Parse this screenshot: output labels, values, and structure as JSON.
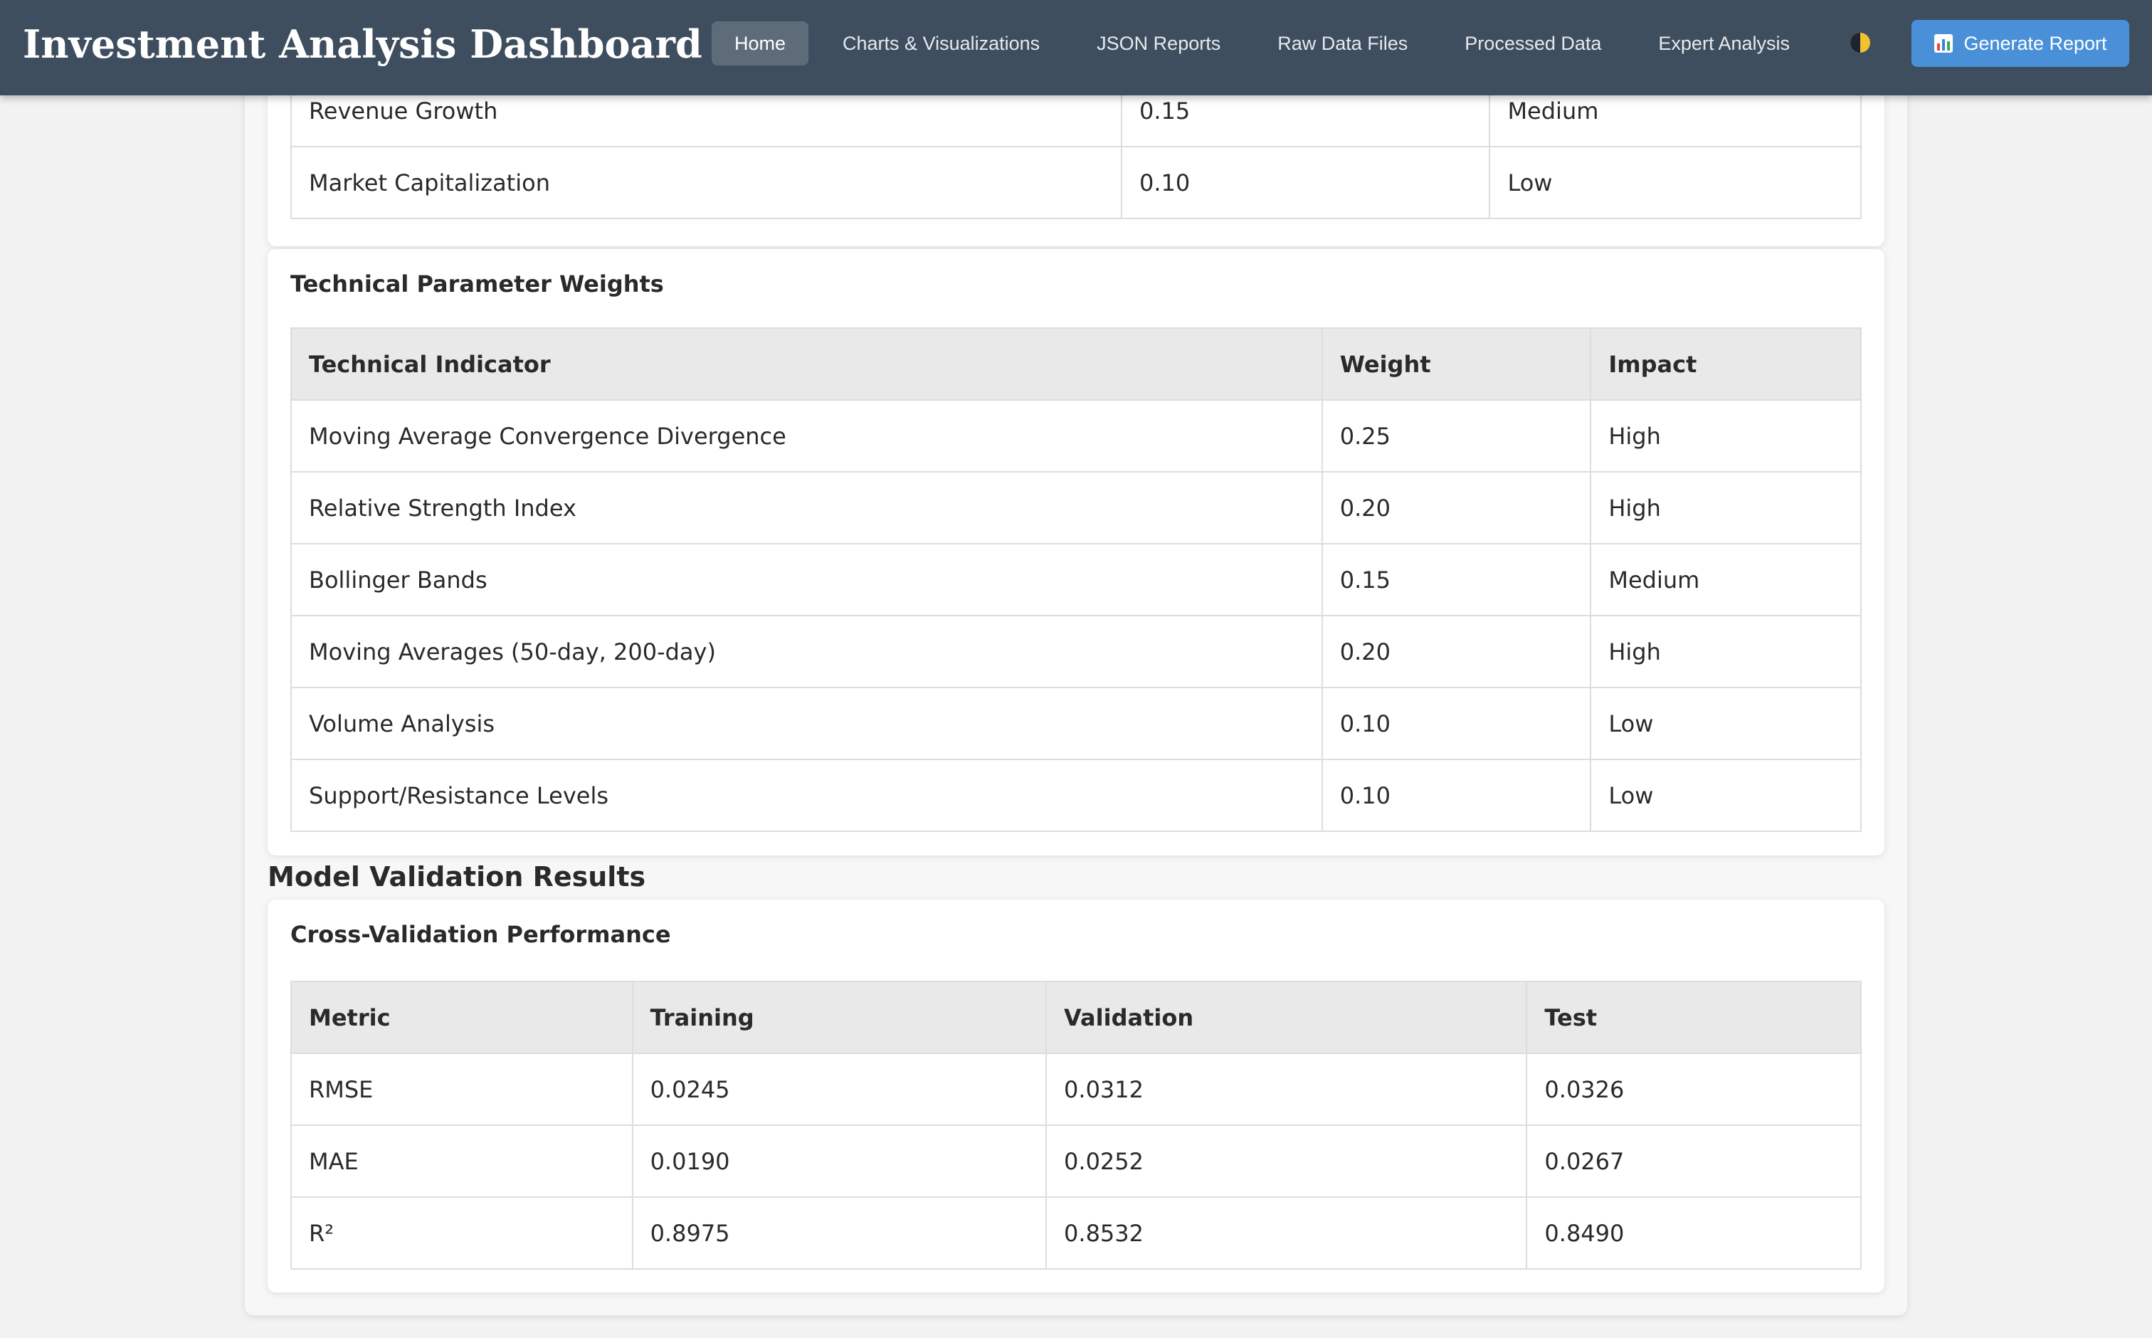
{
  "header": {
    "title": "Investment Analysis Dashboard",
    "nav": [
      {
        "label": "Home",
        "active": true
      },
      {
        "label": "Charts & Visualizations",
        "active": false
      },
      {
        "label": "JSON Reports",
        "active": false
      },
      {
        "label": "Raw Data Files",
        "active": false
      },
      {
        "label": "Processed Data",
        "active": false
      },
      {
        "label": "Expert Analysis",
        "active": false
      }
    ],
    "theme_toggle_icon": "half-moon-icon",
    "generate_button": {
      "label": "Generate Report",
      "icon": "chart-icon"
    }
  },
  "fundamental_table_partial": {
    "rows": [
      [
        "Revenue Growth",
        "0.15",
        "Medium"
      ],
      [
        "Market Capitalization",
        "0.10",
        "Low"
      ]
    ]
  },
  "technical_weights": {
    "title": "Technical Parameter Weights",
    "columns": [
      "Technical Indicator",
      "Weight",
      "Impact"
    ],
    "rows": [
      [
        "Moving Average Convergence Divergence",
        "0.25",
        "High"
      ],
      [
        "Relative Strength Index",
        "0.20",
        "High"
      ],
      [
        "Bollinger Bands",
        "0.15",
        "Medium"
      ],
      [
        "Moving Averages (50-day, 200-day)",
        "0.20",
        "High"
      ],
      [
        "Volume Analysis",
        "0.10",
        "Low"
      ],
      [
        "Support/Resistance Levels",
        "0.10",
        "Low"
      ]
    ]
  },
  "model_validation": {
    "section_title": "Model Validation Results",
    "card_title": "Cross-Validation Performance",
    "columns": [
      "Metric",
      "Training",
      "Validation",
      "Test"
    ],
    "rows": [
      [
        "RMSE",
        "0.0245",
        "0.0312",
        "0.0326"
      ],
      [
        "MAE",
        "0.0190",
        "0.0252",
        "0.0267"
      ],
      [
        "R²",
        "0.8975",
        "0.8532",
        "0.8490"
      ]
    ]
  },
  "colors": {
    "header_bg": "#3f4e5f",
    "nav_active_bg": "#5e6b79",
    "primary_button": "#4a90d9",
    "page_bg": "#f2f2f2",
    "table_header_bg": "#e9e9e9"
  }
}
